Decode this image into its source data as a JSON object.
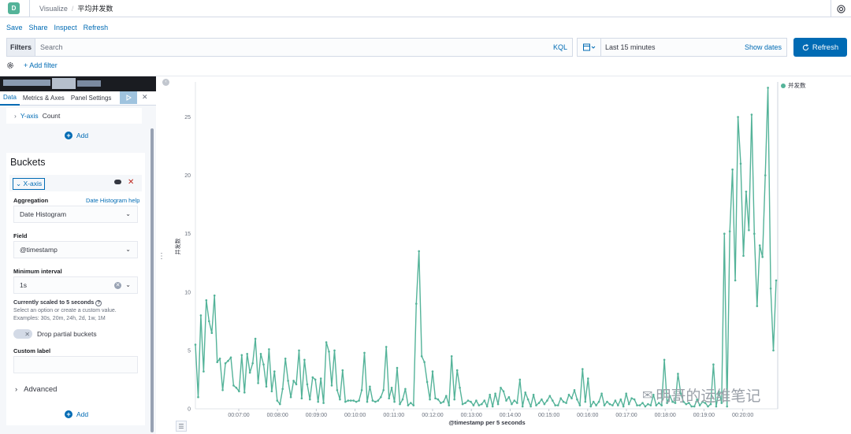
{
  "header": {
    "logo_letter": "D",
    "crumb_app": "Visualize",
    "crumb_separator": "/",
    "crumb_page": "平均并发数"
  },
  "topnav": {
    "save": "Save",
    "share": "Share",
    "inspect": "Inspect",
    "refresh": "Refresh"
  },
  "querybar": {
    "filters_label": "Filters",
    "search_placeholder": "Search",
    "kql": "KQL",
    "time_range": "Last 15 minutes",
    "show_dates": "Show dates",
    "refresh_button": "Refresh",
    "add_filter": "+ Add filter"
  },
  "editor": {
    "tabs": [
      "Data",
      "Metrics & Axes",
      "Panel Settings"
    ],
    "yaxis_prefix": "Y-axis",
    "yaxis_agg": "Count",
    "add_label": "Add",
    "buckets_title": "Buckets",
    "xaxis_label": "X-axis",
    "aggregation_label": "Aggregation",
    "aggregation_help": "Date Histogram help",
    "aggregation_value": "Date Histogram",
    "field_label": "Field",
    "field_value": "@timestamp",
    "min_interval_label": "Minimum interval",
    "min_interval_value": "1s",
    "scaled_note": "Currently scaled to 5 seconds",
    "help_line1": "Select an option or create a custom value.",
    "help_line2": "Examples: 30s, 20m, 24h, 2d, 1w, 1M",
    "drop_partial": "Drop partial buckets",
    "custom_label": "Custom label",
    "advanced": "Advanced"
  },
  "watermark": "明哥的运维笔记",
  "colors": {
    "accent": "#006bb4",
    "series": "#54b399",
    "logo": "#54b399"
  },
  "chart_data": {
    "type": "line",
    "title": "",
    "xlabel": "@timestamp per 5 seconds",
    "ylabel": "并发数",
    "ylim": [
      0,
      28
    ],
    "y_ticks": [
      0,
      5,
      10,
      15,
      20,
      25
    ],
    "x_ticks": [
      "00:07:00",
      "00:08:00",
      "00:09:00",
      "00:10:00",
      "00:11:00",
      "00:12:00",
      "00:13:00",
      "00:14:00",
      "00:15:00",
      "00:16:00",
      "00:17:00",
      "00:18:00",
      "00:19:00",
      "00:20:00"
    ],
    "legend_position": "top-right",
    "series": [
      {
        "name": "并发数",
        "values": [
          5.5,
          1,
          8,
          3.2,
          9.3,
          7.5,
          6.5,
          9.7,
          4,
          4.3,
          1.6,
          3.9,
          4.1,
          4.4,
          2,
          1.8,
          1.5,
          4.6,
          1.4,
          4.7,
          3.1,
          3.9,
          6,
          2.2,
          4.7,
          3.8,
          1.9,
          5.1,
          1.5,
          3.2,
          0.7,
          0.4,
          1.7,
          4.3,
          2.4,
          1,
          2.4,
          2.1,
          5,
          0.9,
          4.2,
          2.1,
          0.8,
          2.7,
          2.5,
          0.6,
          2.6,
          0.5,
          5.7,
          4.9,
          2,
          5,
          1.6,
          0.8,
          3.3,
          0.6,
          0.7,
          0.7,
          0.7,
          0.6,
          0.7,
          1.6,
          4.8,
          0.6,
          1.9,
          0.7,
          0.6,
          0.7,
          1,
          1.6,
          5.3,
          0.9,
          1.8,
          0.6,
          3.5,
          0.4,
          0.8,
          1.7,
          0.3,
          0.5,
          0.3,
          9,
          13.5,
          4.5,
          4,
          2.3,
          0.8,
          3.2,
          0.9,
          0.8,
          0.5,
          0.6,
          1.1,
          0.3,
          4.5,
          0.8,
          3.3,
          1.8,
          0.4,
          0.5,
          0.7,
          0.6,
          0.3,
          0.7,
          0.3,
          0.4,
          0.7,
          0.2,
          1.2,
          0.2,
          1.3,
          0.4,
          1.8,
          1.5,
          0.7,
          1,
          0.4,
          0.7,
          0.5,
          2.5,
          0.2,
          1.4,
          0.8,
          0.2,
          1.2,
          0.3,
          0.5,
          0.8,
          0.4,
          0.7,
          1.1,
          0.7,
          0.3,
          0.3,
          0.9,
          0.6,
          0.5,
          1.2,
          0.9,
          1.6,
          0.8,
          0.3,
          3.4,
          0.6,
          2.6,
          0.2,
          0.6,
          0.3,
          0.6,
          1.3,
          0.3,
          0.6,
          0.4,
          0.3,
          0.7,
          0.3,
          0.8,
          0.2,
          1.3,
          0.4,
          0.9,
          0.8,
          0.3,
          0.3,
          0.5,
          0.2,
          0.4,
          0.3,
          1.2,
          0.3,
          0.5,
          0.3,
          4.2,
          0.5,
          1.1,
          0.6,
          0.5,
          3,
          1.3,
          0.6,
          0.4,
          0.5,
          0.2,
          0.2,
          0.8,
          0.3,
          0.6,
          0.5,
          0.2,
          0.4,
          3.8,
          0.2,
          1.5,
          0.5,
          15,
          0.2,
          15.2,
          20.5,
          11,
          25,
          21,
          13.1,
          18.6,
          15.3,
          25.2,
          15,
          8.8,
          14,
          13,
          20,
          27.5,
          10.3,
          5,
          11
        ]
      }
    ]
  }
}
